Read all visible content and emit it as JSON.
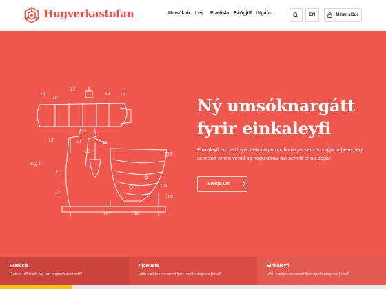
{
  "header": {
    "brand": "Hugverkastofan",
    "nav": [
      {
        "label": "Umsóknir"
      },
      {
        "label": "Leit"
      },
      {
        "label": "Fræðsla"
      },
      {
        "label": "Ráðgjöf"
      },
      {
        "label": "Útgáfa"
      }
    ],
    "search_icon": "search-icon",
    "language": "EN",
    "account_label": "Mínar síður",
    "account_icon": "lock-icon"
  },
  "hero": {
    "title_line1": "Ný umsóknargátt",
    "title_line2": "fyrir einkaleyfi",
    "description": "Einkaleyfi eru veitt fyrir tæknilegar uppfinningar sem eru nýjar á þeim degi sem sótt er um vernd og nógu ólíkar því sem til er nú þegar.",
    "cta_label": "Sækja um",
    "cta_icon": "arrow-right-icon",
    "image": "patent-drawing-mixer"
  },
  "cards": [
    {
      "title": "Fræðsla",
      "text": "Getum við frætt þig um hugverkaréttindi?"
    },
    {
      "title": "Þjónusta",
      "text": "Viltu sækja um vernd fyrir uppfinninguna þína?"
    },
    {
      "title": "Einkaleyfi",
      "text": "Viltu sækja um vernd fyrir uppfinninguna þína?"
    }
  ],
  "colors": {
    "accent": "#f0574d",
    "brand": "#ef4f45",
    "card_dark": "#c9443d",
    "card_mid": "#d84c43",
    "card_light": "#e35a51",
    "bar_yellow": "#f5c518"
  }
}
